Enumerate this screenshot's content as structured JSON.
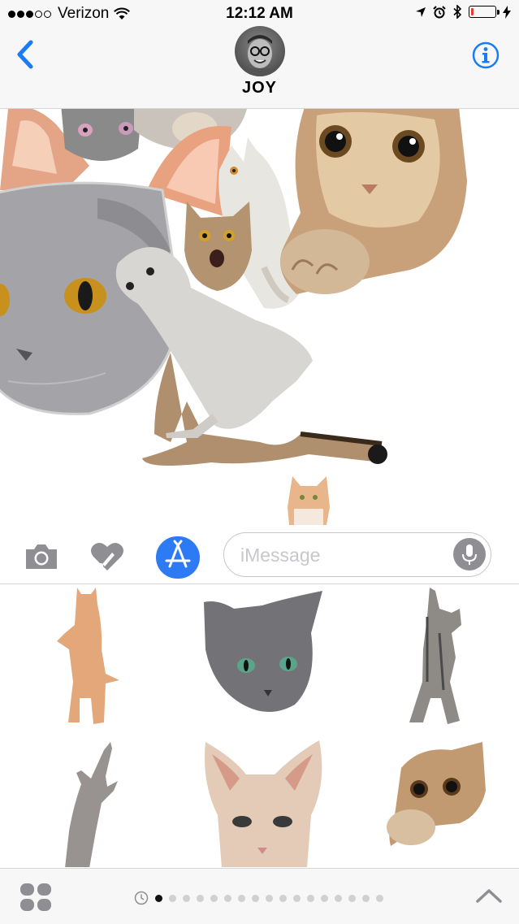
{
  "status_bar": {
    "carrier": "Verizon",
    "time": "12:12 AM",
    "signal_bars_filled": 3,
    "signal_bars_total": 5,
    "battery_level": 0.12,
    "icons": [
      "wifi-icon",
      "location-arrow-icon",
      "alarm-clock-icon",
      "bluetooth-icon",
      "battery-icon",
      "charging-bolt-icon"
    ]
  },
  "header": {
    "contact_name": "JOY",
    "back_icon": "chevron-left-icon",
    "info_icon": "info-circle-icon"
  },
  "conversation": {
    "stickers": [
      "cat-sticker-orange-ear",
      "cat-sticker-grey-small",
      "cat-sticker-big-grey-face",
      "cat-sticker-white-cat",
      "cat-sticker-tabby-surprised",
      "cat-sticker-tabby-peek",
      "cat-sticker-sitting-tabby",
      "cat-sticker-grey-kitten",
      "cat-sticker-tiny-orange"
    ]
  },
  "input_bar": {
    "placeholder": "iMessage",
    "camera_icon": "camera-icon",
    "digital_touch_icon": "digital-touch-heart-icon",
    "app_store_icon": "app-store-icon",
    "mic_icon": "microphone-icon"
  },
  "sticker_drawer": {
    "stickers": [
      "orange-standing-cat",
      "grey-cat-head",
      "tabby-standing-cat",
      "reaching-grey-cat",
      "sphynx-cat-head",
      "peeking-tabby-cat"
    ]
  },
  "bottom_bar": {
    "apps_icon": "four-dots-grid-icon",
    "recents_icon": "clock-icon",
    "page_count": 17,
    "active_page": 1,
    "expand_icon": "chevron-up-icon"
  },
  "colors": {
    "accent_blue": "#1a7cf5",
    "app_store_blue": "#2d7bf4",
    "icon_grey": "#8e8e93",
    "placeholder_grey": "#c7c7cc",
    "battery_red": "#e43a3a"
  }
}
